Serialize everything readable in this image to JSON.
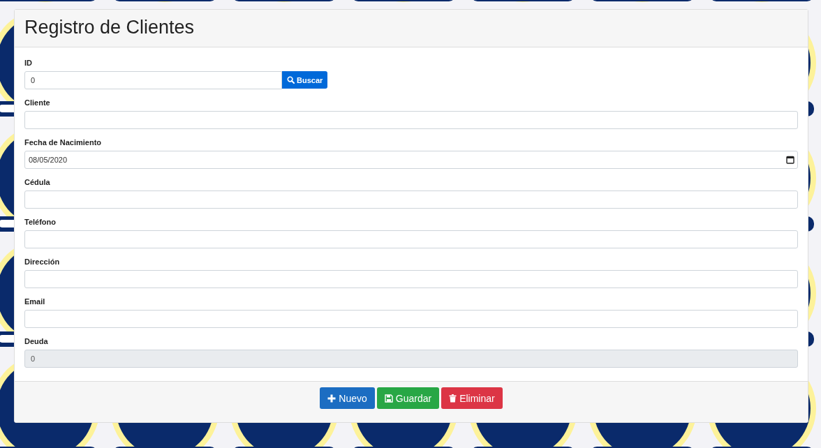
{
  "card": {
    "title": "Registro de Clientes"
  },
  "id_field": {
    "label": "ID",
    "value": "0",
    "button": "Buscar"
  },
  "fields": [
    {
      "kind": "text",
      "label": "Cliente"
    },
    {
      "kind": "date",
      "label": "Fecha de Nacimiento",
      "value": "08/05/2020"
    },
    {
      "kind": "text",
      "label": "Cédula"
    },
    {
      "kind": "text",
      "label": "Teléfono"
    },
    {
      "kind": "text",
      "label": "Dirección"
    },
    {
      "kind": "text",
      "label": "Email"
    },
    {
      "kind": "disabled",
      "label": "Deuda",
      "value": "0"
    }
  ],
  "buttons": [
    {
      "kind": "new",
      "label": "Nuevo"
    },
    {
      "kind": "save",
      "label": "Guardar"
    },
    {
      "kind": "delete",
      "label": "Eliminar"
    }
  ]
}
